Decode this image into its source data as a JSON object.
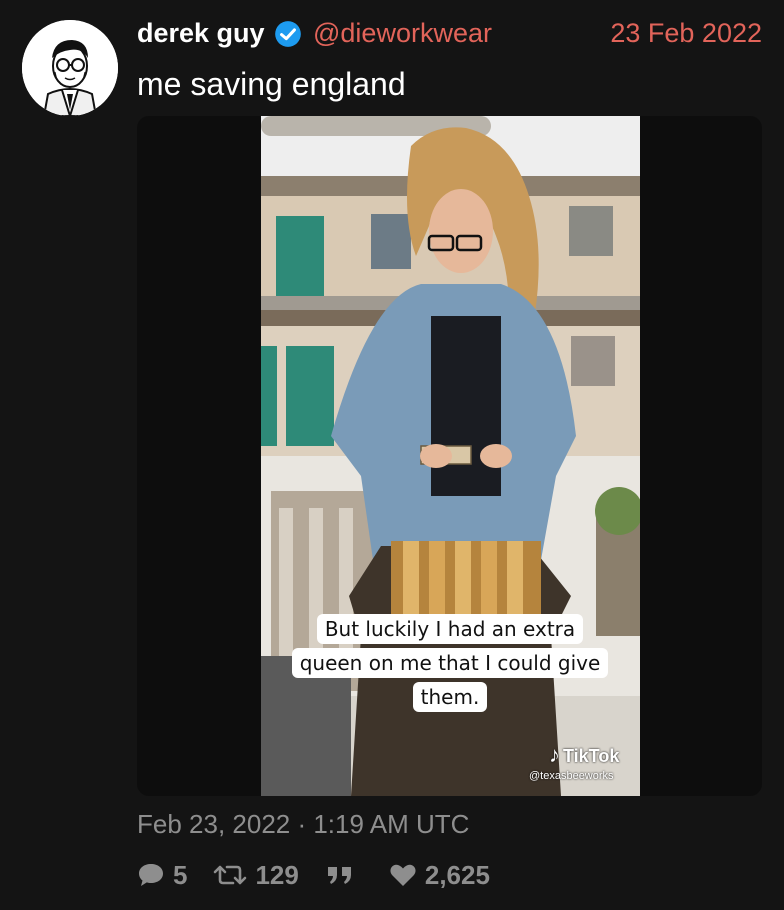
{
  "tweet": {
    "author_name": "derek guy",
    "handle": "@dieworkwear",
    "date": "23 Feb 2022",
    "text": "me saving england",
    "timestamp": "Feb 23, 2022 · 1:19 AM UTC"
  },
  "media": {
    "caption": "But luckily I had an extra queen on me that I could give them.",
    "watermark_brand": "TikTok",
    "watermark_handle": "@texasbeeworks"
  },
  "stats": {
    "replies": "5",
    "retweets": "129",
    "likes": "2,625"
  },
  "icons": [
    "verified-icon",
    "comment-icon",
    "retweet-icon",
    "quote-icon",
    "heart-icon",
    "tiktok-icon"
  ],
  "colors": {
    "background": "#141414",
    "accent": "#e2645a",
    "verified": "#1d9bf0",
    "muted": "#8e8e8e"
  }
}
